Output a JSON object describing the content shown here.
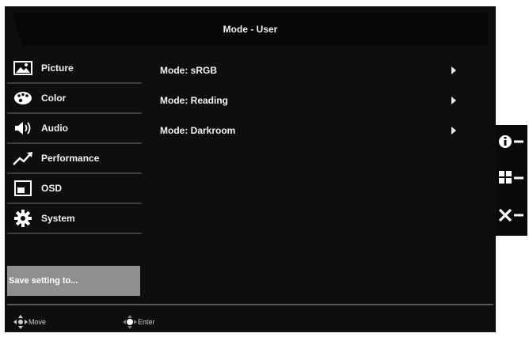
{
  "header": {
    "title": "Mode - User"
  },
  "sidebar": {
    "items": [
      {
        "label": "Picture",
        "icon": "picture-icon"
      },
      {
        "label": "Color",
        "icon": "palette-icon"
      },
      {
        "label": "Audio",
        "icon": "speaker-icon"
      },
      {
        "label": "Performance",
        "icon": "trend-icon"
      },
      {
        "label": "OSD",
        "icon": "osd-window-icon"
      },
      {
        "label": "System",
        "icon": "gear-icon"
      }
    ],
    "save_label": "Save setting to..."
  },
  "modes": [
    {
      "label": "Mode: sRGB"
    },
    {
      "label": "Mode: Reading"
    },
    {
      "label": "Mode: Darkroom"
    }
  ],
  "footer": {
    "move_label": "Move",
    "enter_label": "Enter"
  },
  "hotkeys": [
    {
      "icon": "info-icon"
    },
    {
      "icon": "menu-grid-icon"
    },
    {
      "icon": "close-icon"
    }
  ],
  "colors": {
    "background": "#0e0e0e",
    "save_button": "#8f8f8f",
    "divider": "#3c3c3c"
  }
}
